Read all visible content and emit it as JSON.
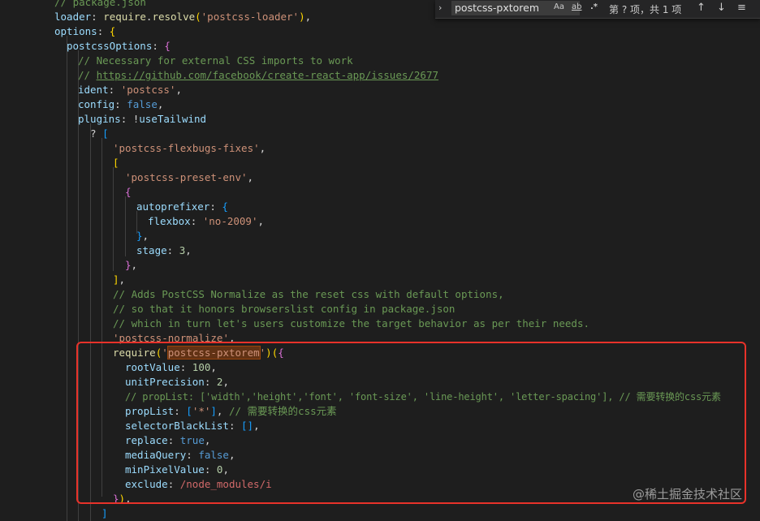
{
  "find_widget": {
    "toggle_icon": "chevron-right-icon",
    "query": "postcss-pxtorem",
    "opt_case": "Aa",
    "opt_word": "ab",
    "opt_regex": ".*",
    "result_count": "第 ? 项，共 1 项",
    "prev": "↑",
    "next": "↓",
    "selection": "≡"
  },
  "code": {
    "l0": {
      "comment": "// package.json"
    },
    "l1": {
      "prop": "loader",
      "punc1": ": ",
      "func": "require",
      "punc2": ".",
      "func2": "resolve",
      "bopen": "(",
      "str": "'postcss-loader'",
      "bclose": ")",
      "punc3": ","
    },
    "l2": {
      "prop": "options",
      "punc1": ": ",
      "bopen": "{"
    },
    "l3": {
      "prop": "postcssOptions",
      "punc1": ": ",
      "bopen": "{"
    },
    "l4": {
      "comment": "// Necessary for external CSS imports to work"
    },
    "l5": {
      "cpre": "// ",
      "link": "https://github.com/facebook/create-react-app/issues/2677"
    },
    "l6": {
      "prop": "ident",
      "punc1": ": ",
      "str": "'postcss'",
      "punc2": ","
    },
    "l7": {
      "prop": "config",
      "punc1": ": ",
      "kw": "false",
      "punc2": ","
    },
    "l8": {
      "prop": "plugins",
      "punc1": ": !",
      "prop2": "useTailwind"
    },
    "l9": {
      "punc1": "? ",
      "bopen": "["
    },
    "l10": {
      "str": "'postcss-flexbugs-fixes'",
      "punc1": ","
    },
    "l11": {
      "bopen": "["
    },
    "l12": {
      "str": "'postcss-preset-env'",
      "punc1": ","
    },
    "l13": {
      "bopen": "{"
    },
    "l14": {
      "prop": "autoprefixer",
      "punc1": ": ",
      "bopen": "{"
    },
    "l15": {
      "prop": "flexbox",
      "punc1": ": ",
      "str": "'no-2009'",
      "punc2": ","
    },
    "l16": {
      "bclose": "}",
      "punc1": ","
    },
    "l17": {
      "prop": "stage",
      "punc1": ": ",
      "num": "3",
      "punc2": ","
    },
    "l18": {
      "bclose": "}",
      "punc1": ","
    },
    "l19": {
      "bclose": "]",
      "punc1": ","
    },
    "l20": {
      "comment": "// Adds PostCSS Normalize as the reset css with default options,"
    },
    "l21": {
      "comment": "// so that it honors browserslist config in package.json"
    },
    "l22": {
      "comment": "// which in turn let's users customize the target behavior as per their needs."
    },
    "l23": {
      "str": "'postcss-normalize'",
      "punc1": ","
    },
    "l24": {
      "func": "require",
      "bopen": "(",
      "str1": "'",
      "str_hl": "postcss-pxtorem",
      "str2": "'",
      "bclose": ")",
      "bopen2": "(",
      "bopen3": "{"
    },
    "l25": {
      "prop": "rootValue",
      "punc1": ": ",
      "num": "100",
      "punc2": ","
    },
    "l26": {
      "prop": "unitPrecision",
      "punc1": ": ",
      "num": "2",
      "punc2": ","
    },
    "l27": {
      "comment": "// propList: ['width','height','font', 'font-size', 'line-height', 'letter-spacing'], // 需要转换的css元素"
    },
    "l28": {
      "prop": "propList",
      "punc1": ": ",
      "bopen": "[",
      "str": "'*'",
      "bclose": "]",
      "punc2": ", ",
      "comment": "// 需要转换的css元素"
    },
    "l29": {
      "prop": "selectorBlackList",
      "punc1": ": ",
      "bopen": "[",
      "bclose": "]",
      "punc2": ","
    },
    "l30": {
      "prop": "replace",
      "punc1": ": ",
      "kw": "true",
      "punc2": ","
    },
    "l31": {
      "prop": "mediaQuery",
      "punc1": ": ",
      "kw": "false",
      "punc2": ","
    },
    "l32": {
      "prop": "minPixelValue",
      "punc1": ": ",
      "num": "0",
      "punc2": ","
    },
    "l33": {
      "prop": "exclude",
      "punc1": ": ",
      "regex": "/node_modules/i"
    },
    "l34": {
      "bclose": "}",
      "bclose2": ")",
      "punc1": ","
    },
    "l35": {
      "bclose": "]"
    }
  },
  "watermark": "@稀土掘金技术社区"
}
